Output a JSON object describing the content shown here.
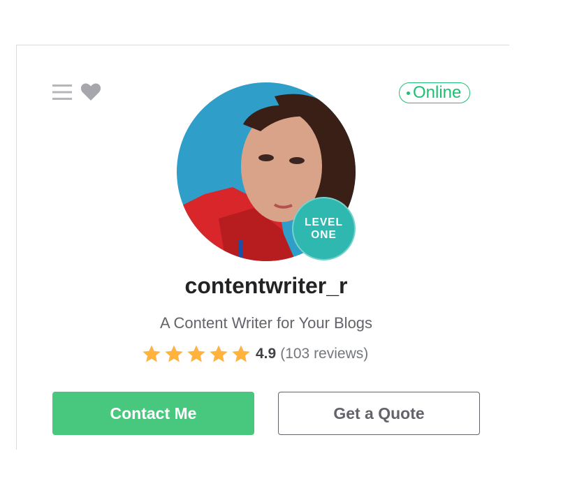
{
  "status": {
    "label": "Online",
    "color": "#1dbf73"
  },
  "profile": {
    "username": "contentwriter_r",
    "tagline": "A Content Writer for Your Blogs",
    "level": {
      "line1": "LEVEL",
      "line2": "ONE"
    },
    "avatar_icon": "profile-photo"
  },
  "rating": {
    "stars": 5,
    "score": "4.9",
    "reviews": "(103 reviews)",
    "star_color": "#ffb33e"
  },
  "actions": {
    "contact_label": "Contact Me",
    "quote_label": "Get a Quote",
    "accent": "#48c77e"
  },
  "icons": {
    "menu": "hamburger-menu-icon",
    "favorite": "heart-icon"
  }
}
